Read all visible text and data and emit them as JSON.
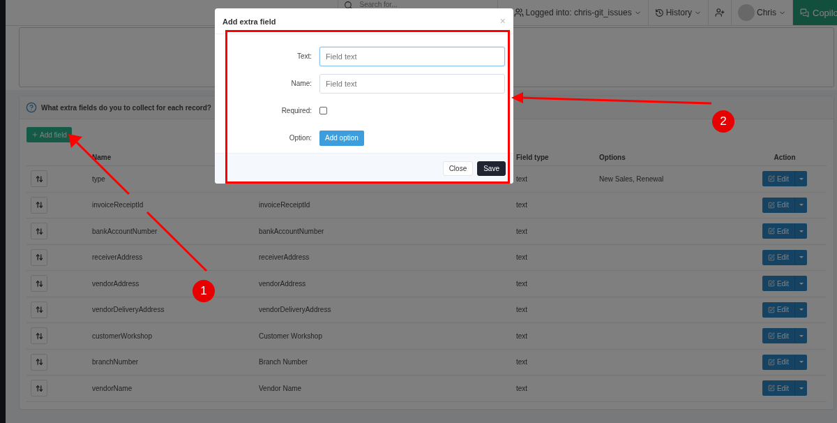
{
  "navbar": {
    "search": {
      "placeholder": "Search for..."
    },
    "account": "Logged into: chris-git_issues",
    "history": "History",
    "user": "Chris",
    "copilot": "Copilo"
  },
  "panel": {
    "title": "What extra fields do you to collect for each record?",
    "add_button": "Add field",
    "columns": {
      "name": "Name",
      "field_type": "Field type",
      "options": "Options",
      "action": "Action"
    },
    "rows": [
      {
        "name": "type",
        "field_type": "text",
        "options": "New Sales, Renewal",
        "action": "Edit"
      },
      {
        "name": "invoiceReceiptId",
        "label": "invoiceReceiptId",
        "field_type": "text",
        "action": "Edit"
      },
      {
        "name": "bankAccountNumber",
        "label": "bankAccountNumber",
        "field_type": "text",
        "action": "Edit"
      },
      {
        "name": "receiverAddress",
        "label": "receiverAddress",
        "field_type": "text",
        "action": "Edit"
      },
      {
        "name": "vendorAddress",
        "label": "vendorAddress",
        "field_type": "text",
        "action": "Edit"
      },
      {
        "name": "vendorDeliveryAddress",
        "label": "vendorDeliveryAddress",
        "field_type": "text",
        "action": "Edit"
      },
      {
        "name": "customerWorkshop",
        "label": "Customer Workshop",
        "field_type": "text",
        "action": "Edit"
      },
      {
        "name": "branchNumber",
        "label": "Branch Number",
        "field_type": "text",
        "action": "Edit"
      },
      {
        "name": "vendorName",
        "label": "Vendor Name",
        "field_type": "text",
        "action": "Edit"
      }
    ]
  },
  "modal": {
    "title": "Add extra field",
    "close": "×",
    "fields": [
      {
        "kind": "input",
        "label": "Text:",
        "placeholder": "Field text",
        "focused": true
      },
      {
        "kind": "input",
        "label": "Name:",
        "placeholder": "Field text",
        "focused": false
      },
      {
        "kind": "checkbox",
        "label": "Required:",
        "checked": false
      },
      {
        "kind": "button",
        "label": "Option:",
        "button": "Add option"
      }
    ],
    "buttons": [
      {
        "kind": "default",
        "label": "Close"
      },
      {
        "kind": "primary",
        "label": "Save"
      }
    ]
  },
  "annotations": {
    "badges": [
      {
        "number": "1"
      },
      {
        "number": "2"
      }
    ]
  }
}
